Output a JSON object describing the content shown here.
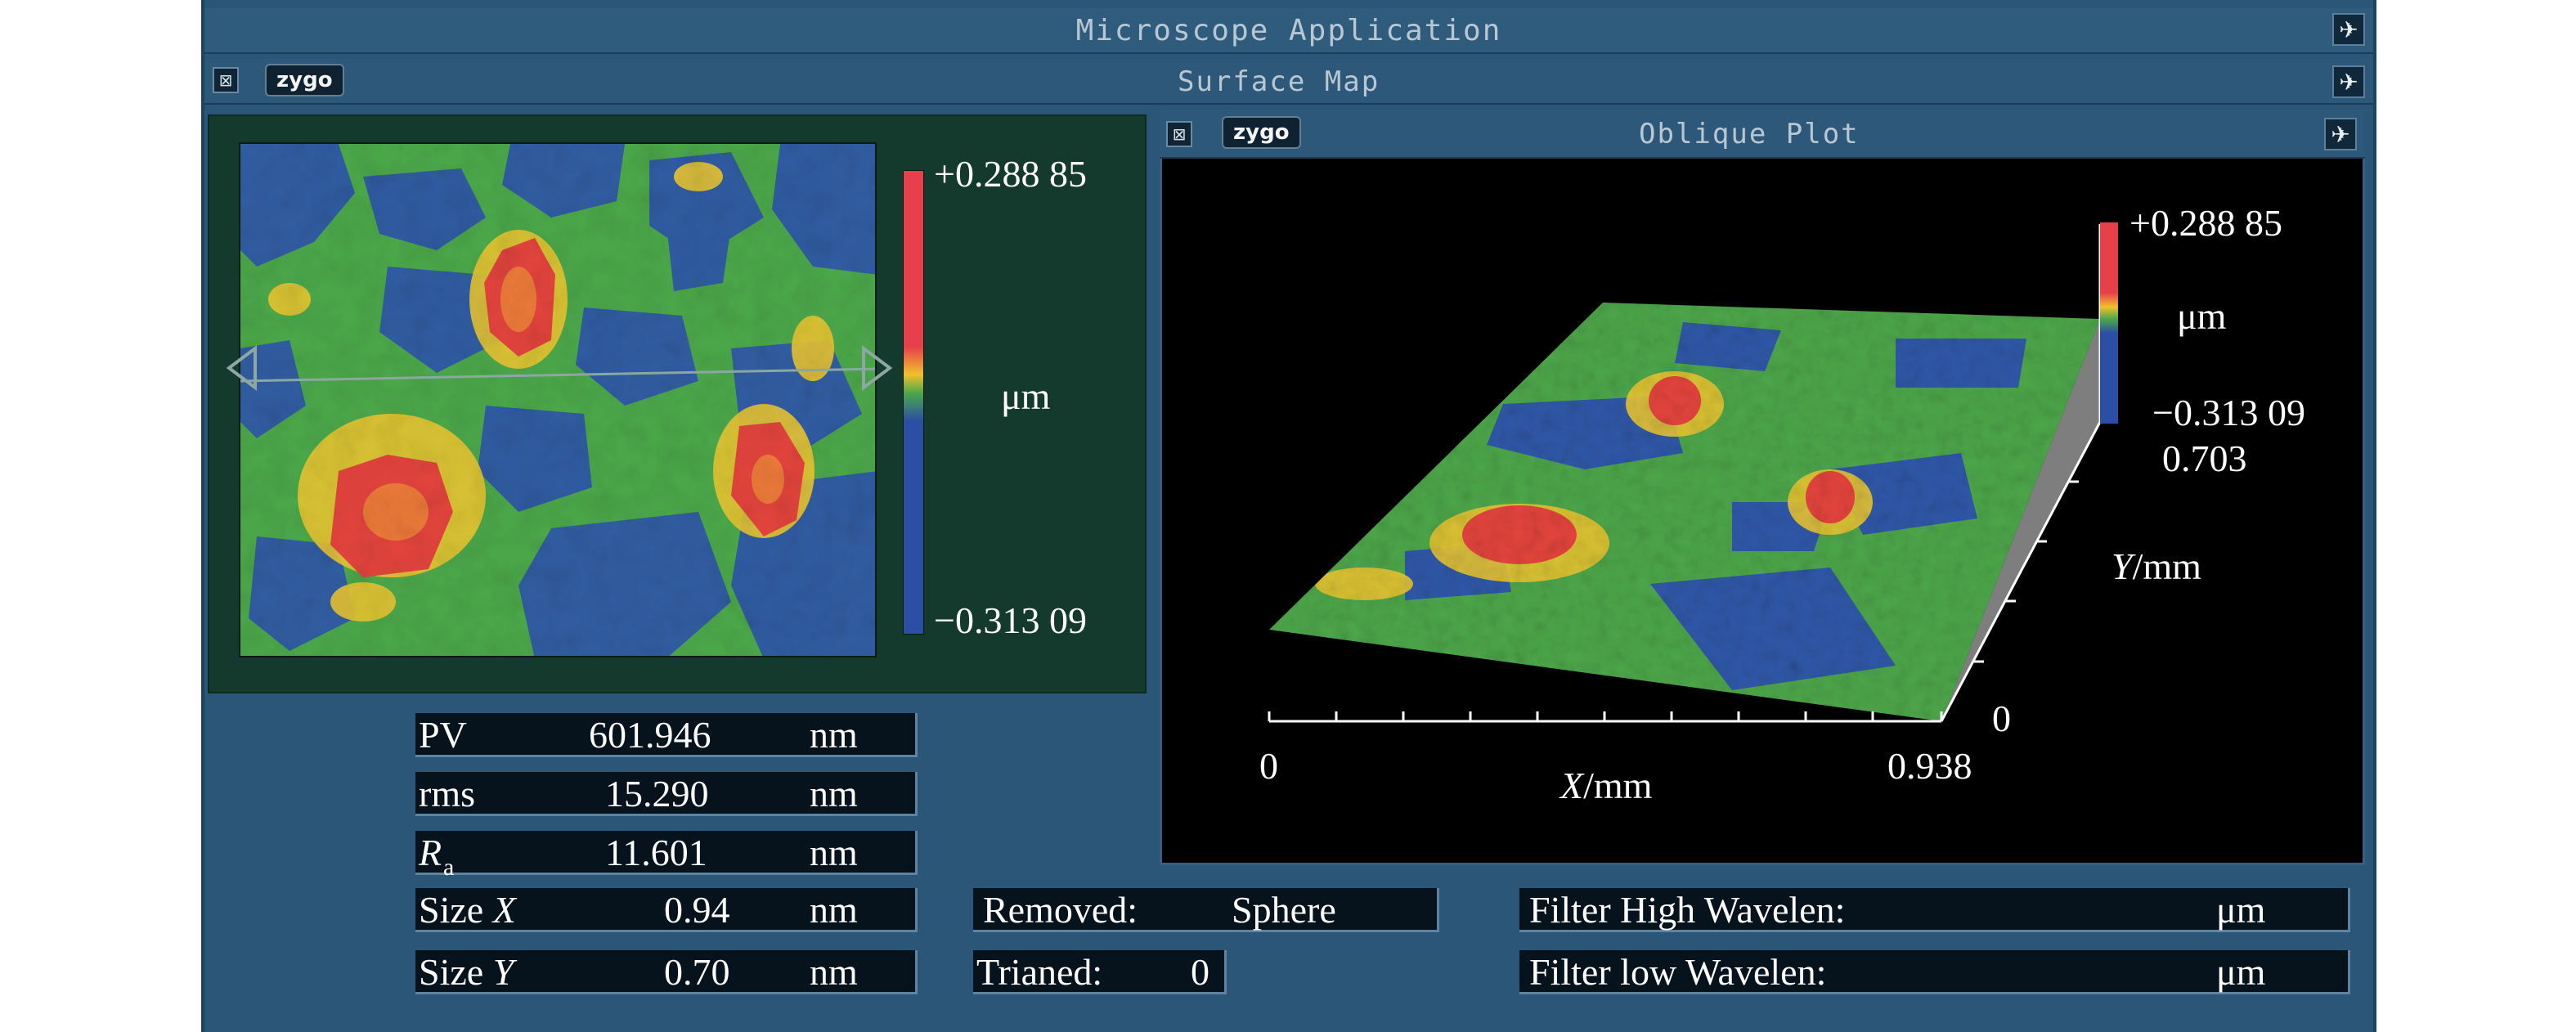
{
  "window": {
    "title": "Microscope Application",
    "subtitle": "Surface Map",
    "brand": "zygo",
    "close_glyph": "⊠",
    "pin_glyph": "✈"
  },
  "surface_map": {
    "colorbar_max": "+0.288 85",
    "colorbar_unit": "μm",
    "colorbar_min": "−0.313 09",
    "colors": {
      "high": "#e8404a",
      "mid_high": "#f0c02c",
      "mid": "#4ca84a",
      "low": "#2b4fa4"
    }
  },
  "oblique_plot": {
    "title": "Oblique Plot",
    "colorbar_max": "+0.288 85",
    "colorbar_unit": "μm",
    "colorbar_min": "−0.313 09",
    "y_max": "0.703",
    "y_label_italic": "Y",
    "y_label_unit": "/mm",
    "y_zero": "0",
    "x_zero": "0",
    "x_max": "0.938",
    "x_label_italic": "X",
    "x_label_unit": "/mm"
  },
  "stats": [
    {
      "label": "PV",
      "value": "601.946",
      "unit": "nm"
    },
    {
      "label": "rms",
      "value": "15.290",
      "unit": "nm"
    },
    {
      "label": "R",
      "label_sub": "a",
      "value": "11.601",
      "unit": "nm"
    },
    {
      "label": "Size ",
      "label_italic": "X",
      "value": "0.94",
      "unit": "nm"
    },
    {
      "label": "Size ",
      "label_italic": "Y",
      "value": "0.70",
      "unit": "nm"
    }
  ],
  "removed": {
    "label": "Removed:",
    "value": "Sphere"
  },
  "trianed": {
    "label": "Trianed:",
    "value": "0"
  },
  "filter_high": {
    "label": "Filter High Wavelen:",
    "unit": "μm"
  },
  "filter_low": {
    "label": "Filter low Wavelen:",
    "unit": "μm"
  }
}
